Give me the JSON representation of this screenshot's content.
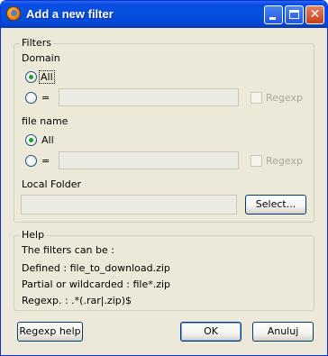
{
  "window": {
    "title": "Add a new filter"
  },
  "filters": {
    "legend": "Filters",
    "domain": {
      "label": "Domain",
      "all_label": "All",
      "equals_label": "=",
      "value": "",
      "regexp_label": "Regexp",
      "selected": "All"
    },
    "file_name": {
      "label": "file name",
      "all_label": "All",
      "equals_label": "=",
      "value": "",
      "regexp_label": "Regexp",
      "selected": "All"
    },
    "local_folder": {
      "label": "Local Folder",
      "value": "",
      "select_button": "Select..."
    }
  },
  "help": {
    "legend": "Help",
    "lines": [
      "The filters can be :",
      "Defined : file_to_download.zip",
      "Partial or wildcarded : file*.zip",
      "Regexp. : .*(.rar|.zip)$"
    ]
  },
  "buttons": {
    "regexp_help": "Regexp help",
    "ok": "OK",
    "cancel": "Anuluj"
  },
  "icons": {
    "app": "app-icon",
    "minimize": "minimize-icon",
    "maximize": "maximize-icon",
    "close": "close-icon"
  },
  "colors": {
    "titlebar": "#0550df",
    "dialog_bg": "#ece9d8",
    "radio_dot": "#21a121",
    "disabled_text": "#aca899"
  }
}
